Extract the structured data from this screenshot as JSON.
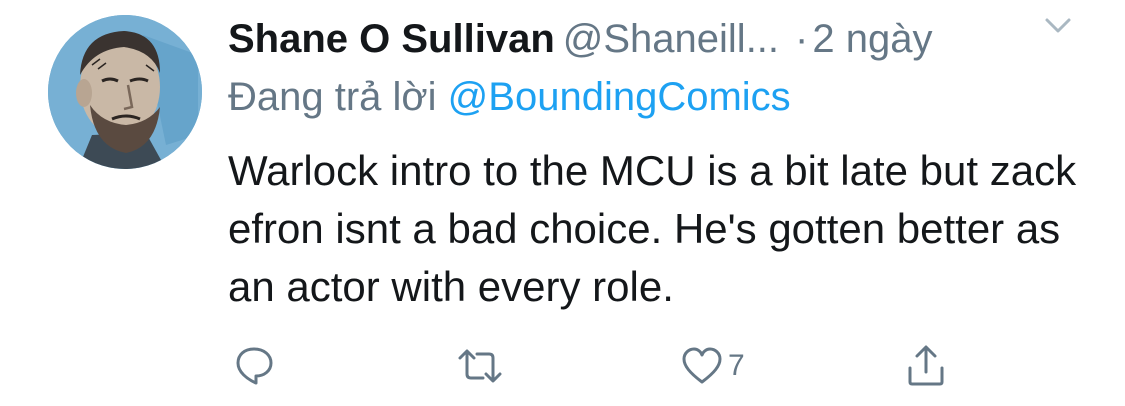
{
  "tweet": {
    "author_name": "Shane O Sullivan",
    "author_handle": "@Shaneill...",
    "dot": "·",
    "time": "2 ngày",
    "reply_prefix": "Đang trả lời",
    "reply_to": "@BoundingComics",
    "text": "Warlock intro to the MCU is a bit late but zack efron isnt a bad choice. He's gotten better as an actor with every role.",
    "like_count": "7"
  },
  "icons": {
    "menu": "chevron-down-icon",
    "reply": "reply-bubble-icon",
    "retweet": "retweet-icon",
    "like": "heart-icon",
    "share": "share-icon"
  },
  "colors": {
    "name": "#14171a",
    "secondary": "#657786",
    "link": "#1da1f2",
    "avatar_bg": "#6aa8cf"
  }
}
